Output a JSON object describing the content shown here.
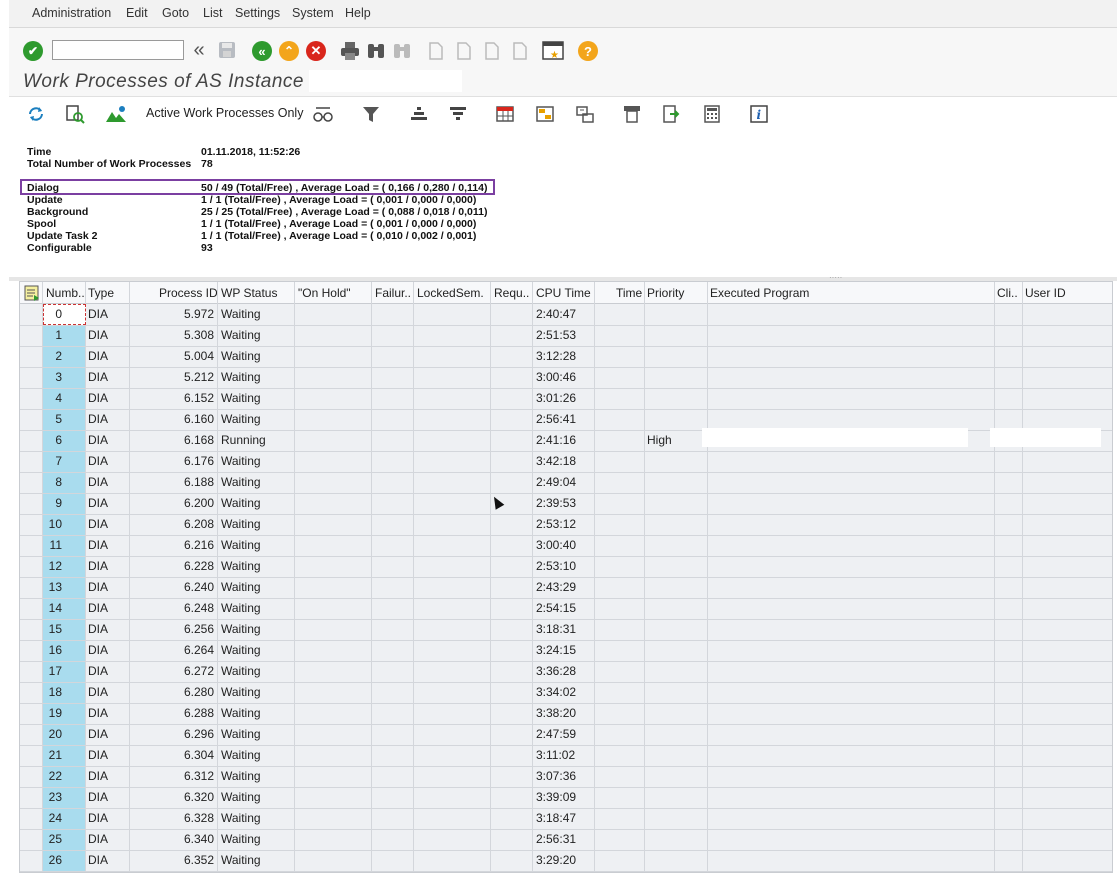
{
  "menu": [
    "Administration",
    "Edit",
    "Goto",
    "List",
    "Settings",
    "System",
    "Help"
  ],
  "toolbar1": {
    "command_value": "",
    "icons": [
      "enter-icon",
      "back-arrows-icon",
      "save-icon",
      "back-icon",
      "exit-icon",
      "cancel-icon",
      "print-icon",
      "find-icon",
      "find-next-icon",
      "first-page-icon",
      "previous-page-icon",
      "next-page-icon",
      "last-page-icon",
      "create-session-icon",
      "help-icon"
    ]
  },
  "page_title": "Work Processes of AS Instance",
  "toolbar2": {
    "active_only_label": "Active Work Processes Only"
  },
  "info": {
    "time_label": "Time",
    "time_value": "01.11.2018, 11:52:26",
    "total_label": "Total Number of Work Processes",
    "total_value": "78",
    "dialog_label": "Dialog",
    "dialog_value": "50 / 49 (Total/Free) , Average Load = ( 0,166 / 0,280 / 0,114)",
    "update_label": "Update",
    "update_value": "1 / 1 (Total/Free) , Average Load = ( 0,001 / 0,000 / 0,000)",
    "background_label": "Background",
    "background_value": "25 / 25 (Total/Free) , Average Load = ( 0,088 / 0,018 / 0,011)",
    "spool_label": "Spool",
    "spool_value": "1 / 1 (Total/Free) , Average Load = ( 0,001 / 0,000 / 0,000)",
    "update2_label": "Update Task 2",
    "update2_value": "1 / 1 (Total/Free) , Average Load = ( 0,010 / 0,002 / 0,001)",
    "config_label": "Configurable",
    "config_value": "93"
  },
  "table": {
    "columns": [
      "Numb..",
      "Type",
      "Process ID",
      "WP Status",
      "\"On Hold\"",
      "Failur..",
      "LockedSem.",
      "Requ..",
      "CPU Time",
      "Time",
      "Priority",
      "Executed Program",
      "Cli..",
      "User ID"
    ],
    "rows": [
      {
        "num": "0",
        "type": "DIA",
        "pid": "5.972",
        "status": "Waiting",
        "cpu": "2:40:47",
        "priority": ""
      },
      {
        "num": "1",
        "type": "DIA",
        "pid": "5.308",
        "status": "Waiting",
        "cpu": "2:51:53",
        "priority": ""
      },
      {
        "num": "2",
        "type": "DIA",
        "pid": "5.004",
        "status": "Waiting",
        "cpu": "3:12:28",
        "priority": ""
      },
      {
        "num": "3",
        "type": "DIA",
        "pid": "5.212",
        "status": "Waiting",
        "cpu": "3:00:46",
        "priority": ""
      },
      {
        "num": "4",
        "type": "DIA",
        "pid": "6.152",
        "status": "Waiting",
        "cpu": "3:01:26",
        "priority": ""
      },
      {
        "num": "5",
        "type": "DIA",
        "pid": "6.160",
        "status": "Waiting",
        "cpu": "2:56:41",
        "priority": ""
      },
      {
        "num": "6",
        "type": "DIA",
        "pid": "6.168",
        "status": "Running",
        "cpu": "2:41:16",
        "priority": "High"
      },
      {
        "num": "7",
        "type": "DIA",
        "pid": "6.176",
        "status": "Waiting",
        "cpu": "3:42:18",
        "priority": ""
      },
      {
        "num": "8",
        "type": "DIA",
        "pid": "6.188",
        "status": "Waiting",
        "cpu": "2:49:04",
        "priority": ""
      },
      {
        "num": "9",
        "type": "DIA",
        "pid": "6.200",
        "status": "Waiting",
        "cpu": "2:39:53",
        "priority": ""
      },
      {
        "num": "10",
        "type": "DIA",
        "pid": "6.208",
        "status": "Waiting",
        "cpu": "2:53:12",
        "priority": ""
      },
      {
        "num": "11",
        "type": "DIA",
        "pid": "6.216",
        "status": "Waiting",
        "cpu": "3:00:40",
        "priority": ""
      },
      {
        "num": "12",
        "type": "DIA",
        "pid": "6.228",
        "status": "Waiting",
        "cpu": "2:53:10",
        "priority": ""
      },
      {
        "num": "13",
        "type": "DIA",
        "pid": "6.240",
        "status": "Waiting",
        "cpu": "2:43:29",
        "priority": ""
      },
      {
        "num": "14",
        "type": "DIA",
        "pid": "6.248",
        "status": "Waiting",
        "cpu": "2:54:15",
        "priority": ""
      },
      {
        "num": "15",
        "type": "DIA",
        "pid": "6.256",
        "status": "Waiting",
        "cpu": "3:18:31",
        "priority": ""
      },
      {
        "num": "16",
        "type": "DIA",
        "pid": "6.264",
        "status": "Waiting",
        "cpu": "3:24:15",
        "priority": ""
      },
      {
        "num": "17",
        "type": "DIA",
        "pid": "6.272",
        "status": "Waiting",
        "cpu": "3:36:28",
        "priority": ""
      },
      {
        "num": "18",
        "type": "DIA",
        "pid": "6.280",
        "status": "Waiting",
        "cpu": "3:34:02",
        "priority": ""
      },
      {
        "num": "19",
        "type": "DIA",
        "pid": "6.288",
        "status": "Waiting",
        "cpu": "3:38:20",
        "priority": ""
      },
      {
        "num": "20",
        "type": "DIA",
        "pid": "6.296",
        "status": "Waiting",
        "cpu": "2:47:59",
        "priority": ""
      },
      {
        "num": "21",
        "type": "DIA",
        "pid": "6.304",
        "status": "Waiting",
        "cpu": "3:11:02",
        "priority": ""
      },
      {
        "num": "22",
        "type": "DIA",
        "pid": "6.312",
        "status": "Waiting",
        "cpu": "3:07:36",
        "priority": ""
      },
      {
        "num": "23",
        "type": "DIA",
        "pid": "6.320",
        "status": "Waiting",
        "cpu": "3:39:09",
        "priority": ""
      },
      {
        "num": "24",
        "type": "DIA",
        "pid": "6.328",
        "status": "Waiting",
        "cpu": "3:18:47",
        "priority": ""
      },
      {
        "num": "25",
        "type": "DIA",
        "pid": "6.340",
        "status": "Waiting",
        "cpu": "2:56:31",
        "priority": ""
      },
      {
        "num": "26",
        "type": "DIA",
        "pid": "6.352",
        "status": "Waiting",
        "cpu": "3:29:20",
        "priority": ""
      }
    ]
  },
  "colors": {
    "accent_purple": "#7b3fa1",
    "number_column": "#a9dcee",
    "enter_green": "#2e9a2e",
    "cancel_red": "#d9261c",
    "help_orange": "#f3a51b"
  }
}
